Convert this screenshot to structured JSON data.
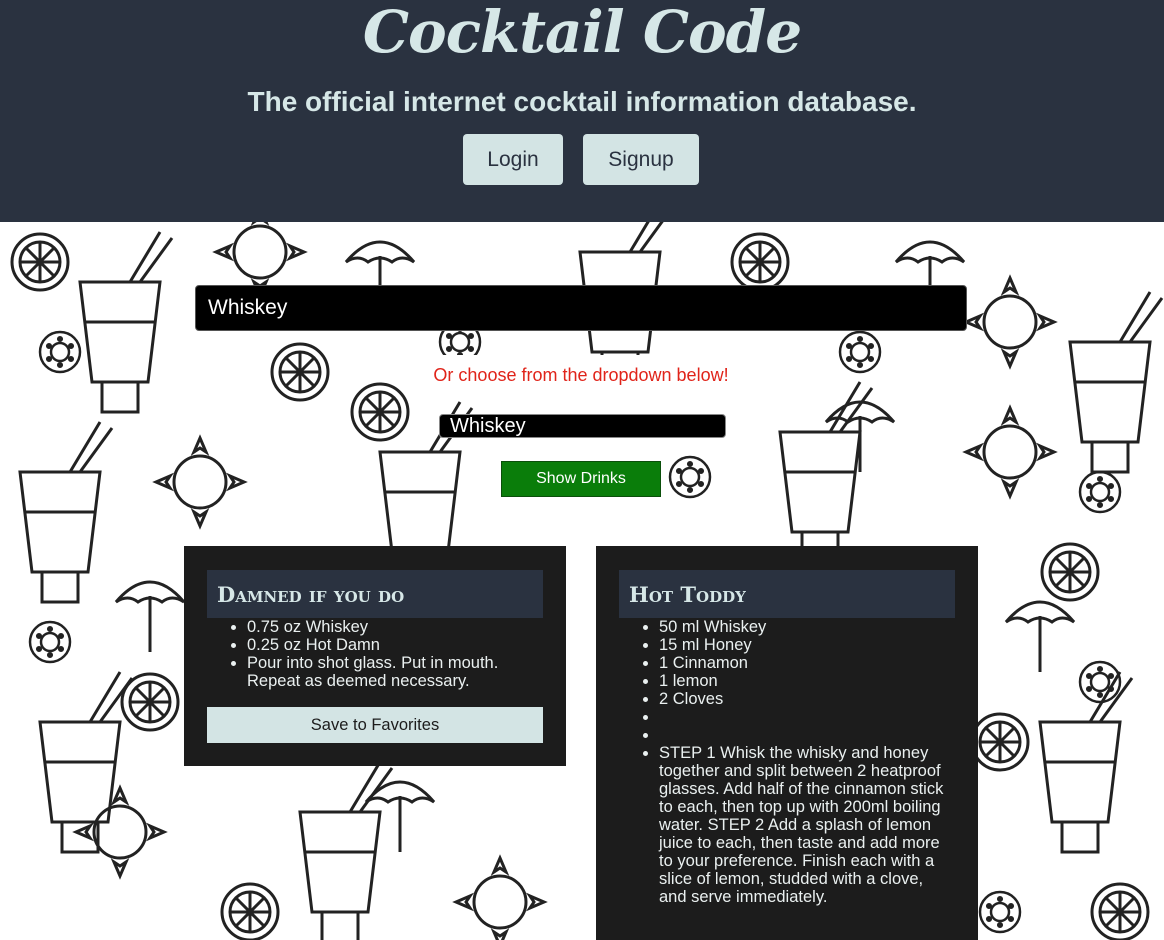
{
  "header": {
    "title": "Cocktail Code",
    "tagline": "The official internet cocktail information database.",
    "login_label": "Login",
    "signup_label": "Signup"
  },
  "search": {
    "value": "Whiskey",
    "hint": "Or choose from the dropdown below!"
  },
  "dropdown": {
    "selected": "Whiskey"
  },
  "show_button": "Show Drinks",
  "cards": [
    {
      "title": "Damned if you do",
      "items": [
        "0.75 oz Whiskey",
        "0.25 oz Hot Damn",
        "Pour into shot glass. Put in mouth. Repeat as deemed necessary."
      ],
      "button": "Save to Favorites"
    },
    {
      "title": "Hot Toddy",
      "items": [
        "50 ml Whiskey",
        "15 ml Honey",
        "1 Cinnamon",
        "1 lemon",
        "2 Cloves",
        "",
        "",
        "STEP 1 Whisk the whisky and honey together and split between 2 heatproof glasses. Add half of the cinnamon stick to each, then top up with 200ml boiling water. STEP 2 Add a splash of lemon juice to each, then taste and add more to your preference. Finish each with a slice of lemon, studded with a clove, and serve immediately."
      ]
    }
  ],
  "colors": {
    "header_bg": "#2a3240",
    "accent_text": "#d6e7e7",
    "card_bg": "#1c1c1c",
    "hint_red": "#e0241a",
    "show_btn_green": "#0a7d0a"
  }
}
